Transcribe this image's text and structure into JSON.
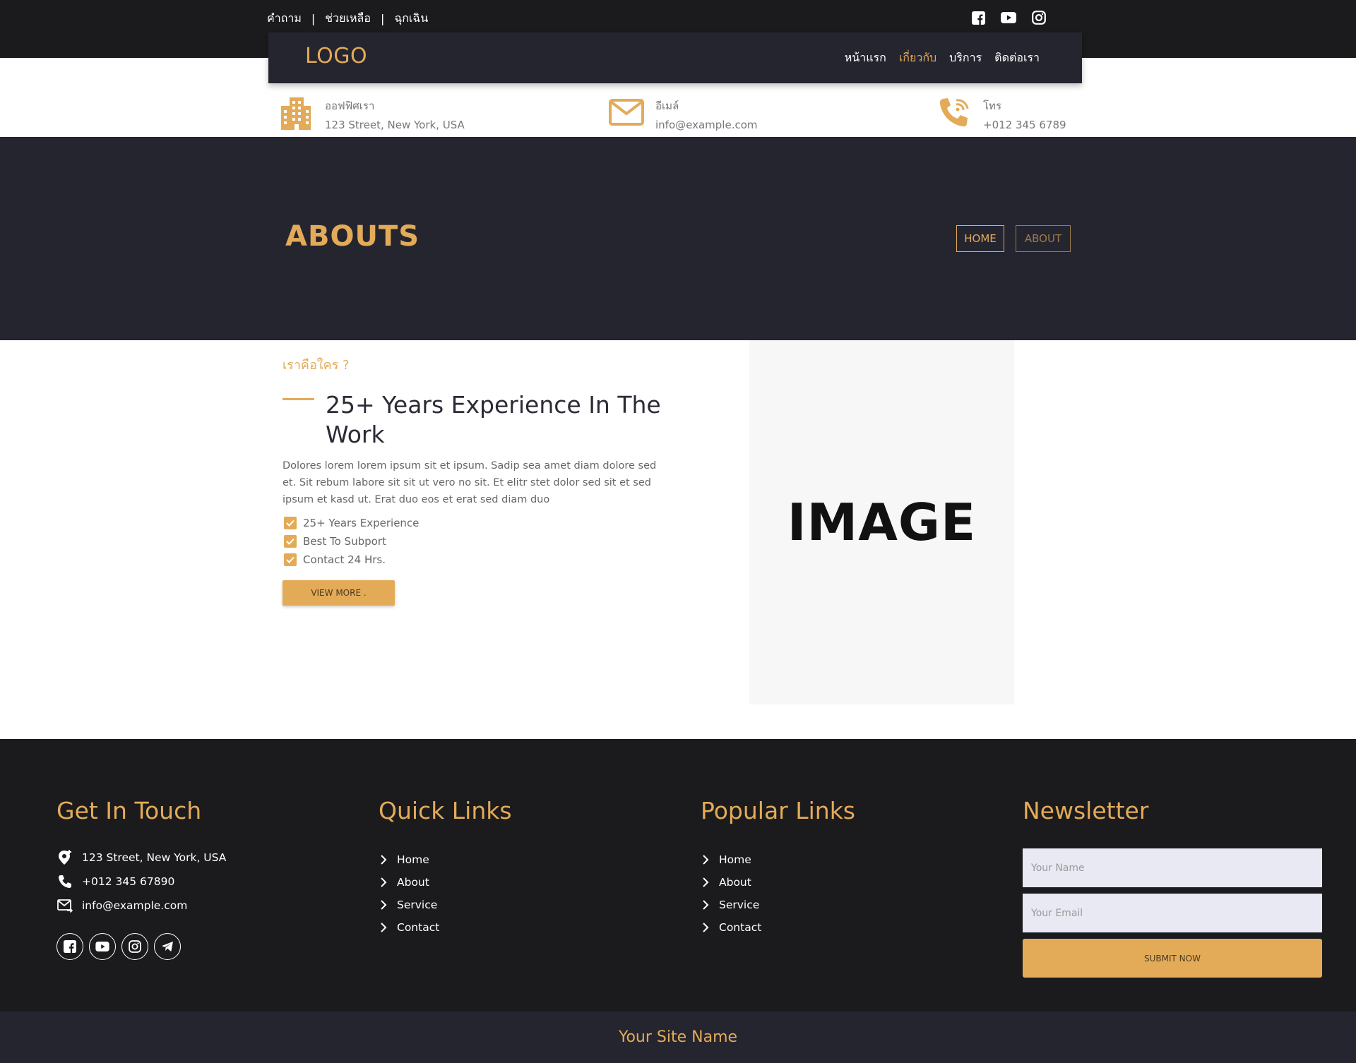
{
  "topbar": {
    "links": [
      "คำถาม",
      "ช่วยเหลือ",
      "ฉุกเฉิน"
    ],
    "separator": "|",
    "social_icons": [
      "facebook-icon",
      "youtube-icon",
      "instagram-icon"
    ]
  },
  "nav": {
    "logo": "LOGO",
    "items": [
      {
        "label": "หน้าแรก",
        "active": false
      },
      {
        "label": "เกี่ยวกับ",
        "active": true
      },
      {
        "label": "บริการ",
        "active": false
      },
      {
        "label": "ติดต่อเรา",
        "active": false
      }
    ]
  },
  "info": {
    "office": {
      "label": "ออฟฟิศเรา",
      "value": "123 Street, New York, USA",
      "icon": "building-icon"
    },
    "email": {
      "label": "อีเมล์",
      "value": "info@example.com",
      "icon": "envelope-icon"
    },
    "phone": {
      "label": "โทร",
      "value": "+012 345 6789",
      "icon": "phone-wifi-icon"
    }
  },
  "hero": {
    "title": "ABOUTS",
    "breadcrumb": {
      "home": "HOME",
      "about": "ABOUT"
    }
  },
  "about": {
    "subtitle": "เราคือใคร ?",
    "heading": "25+ Years Experience In The Work",
    "paragraph": "Dolores lorem lorem ipsum sit et ipsum. Sadip sea amet diam dolore sed et. Sit rebum labore sit sit ut vero no sit. Et elitr stet dolor sed sit et sed ipsum et kasd ut. Erat duo eos et erat sed diam duo",
    "checklist": [
      "25+ Years Experience",
      "Best To Subport",
      "Contact 24 Hrs."
    ],
    "button": "VIEW MORE .",
    "image_label": "IMAGE"
  },
  "footer": {
    "get_in_touch": {
      "title": "Get In Touch",
      "address": "123 Street, New York, USA",
      "phone": "+012 345 67890",
      "email": "info@example.com",
      "socials": [
        "facebook-icon",
        "youtube-icon",
        "instagram-icon",
        "telegram-icon"
      ]
    },
    "quick_links": {
      "title": "Quick Links",
      "items": [
        "Home",
        "About",
        "Service",
        "Contact"
      ]
    },
    "popular_links": {
      "title": "Popular Links",
      "items": [
        "Home",
        "About",
        "Service",
        "Contact"
      ]
    },
    "newsletter": {
      "title": "Newsletter",
      "name_placeholder": "Your Name",
      "email_placeholder": "Your Email",
      "submit": "SUBMIT NOW"
    }
  },
  "bottom": {
    "site_name": "Your Site Name"
  },
  "colors": {
    "accent": "#e3ab58",
    "dark": "#1b1b1d",
    "navy": "#25252f"
  }
}
